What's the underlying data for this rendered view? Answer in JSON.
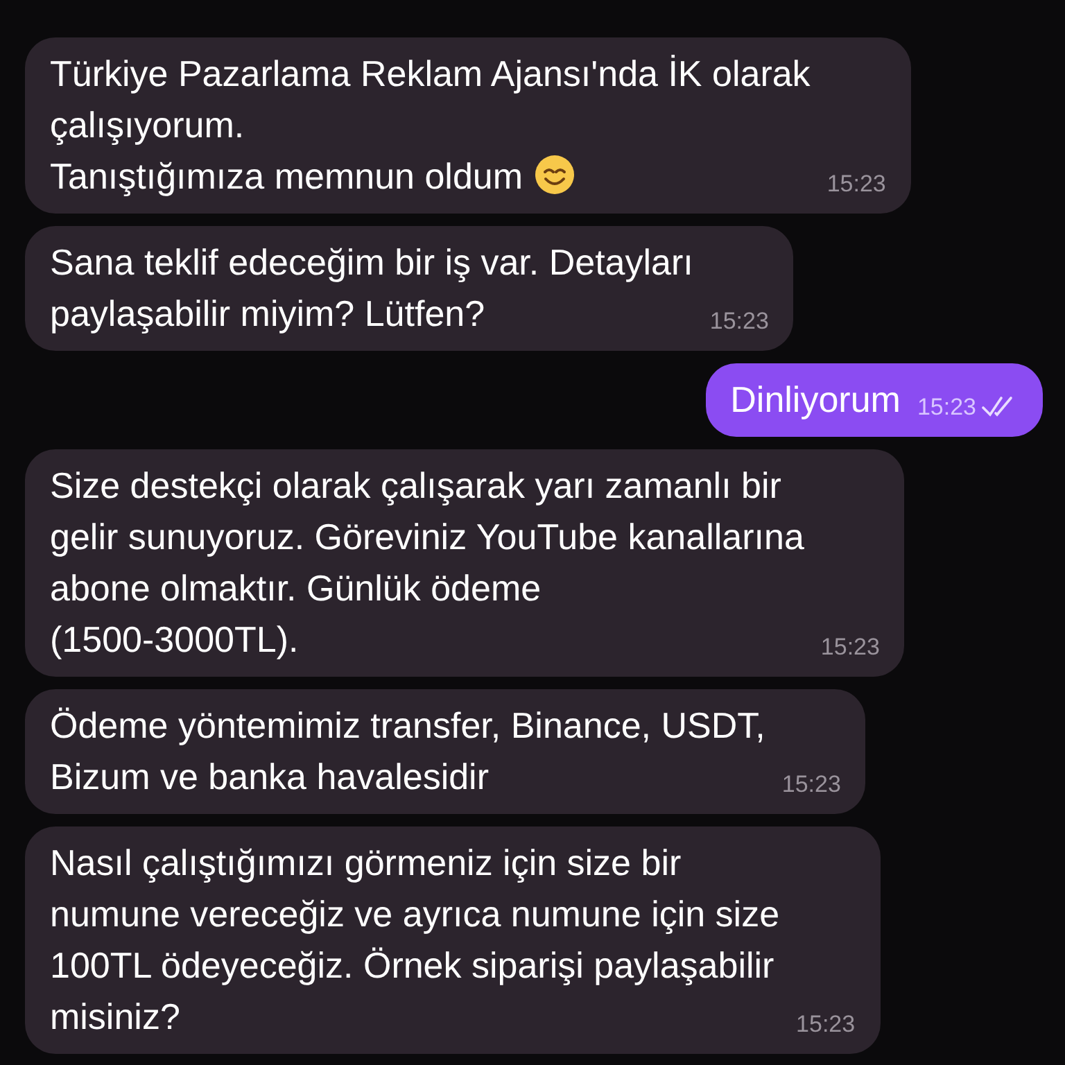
{
  "messages": [
    {
      "kind": "incoming",
      "text": "Türkiye Pazarlama Reklam Ajansı'nda İK olarak\nçalışıyorum.\nTanıştığımıza memnun oldum",
      "emoji": true,
      "time": "15:23"
    },
    {
      "kind": "incoming",
      "text": "Sana teklif edeceğim bir iş var. Detayları\npaylaşabilir miyim? Lütfen?",
      "emoji": false,
      "time": "15:23"
    },
    {
      "kind": "outgoing",
      "text": "Dinliyorum",
      "emoji": false,
      "time": "15:23",
      "read": true
    },
    {
      "kind": "incoming",
      "text": "Size destekçi olarak çalışarak yarı zamanlı bir\ngelir sunuyoruz. Göreviniz YouTube kanallarına\nabone olmaktır. Günlük ödeme\n(1500-3000TL).",
      "emoji": false,
      "time": "15:23"
    },
    {
      "kind": "incoming",
      "text": "Ödeme yöntemimiz transfer, Binance, USDT,\nBizum ve banka havalesidir",
      "emoji": false,
      "time": "15:23"
    },
    {
      "kind": "incoming",
      "text": "Nasıl çalıştığımızı görmeniz için size bir\nnumune vereceğiz ve ayrıca numune için size\n100TL ödeyeceğiz. Örnek siparişi paylaşabilir\nmisiniz?",
      "emoji": false,
      "time": "15:23"
    }
  ]
}
